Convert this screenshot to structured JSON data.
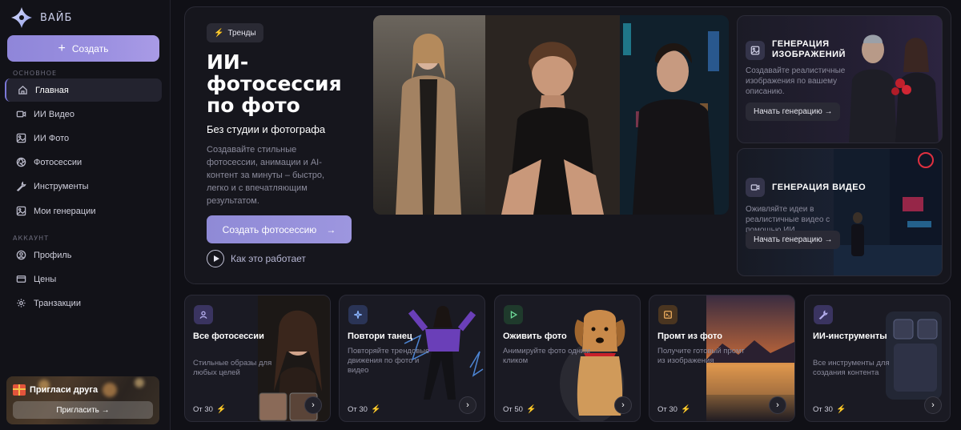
{
  "app": {
    "logo_text": "ВАЙБ"
  },
  "sidebar": {
    "create_label": "Создать",
    "section_main": "ОСНОВНОЕ",
    "section_account": "АККАУНТ",
    "main_items": [
      {
        "label": "Главная",
        "icon": "home-icon"
      },
      {
        "label": "ИИ Видео",
        "icon": "video-icon"
      },
      {
        "label": "ИИ Фото",
        "icon": "image-icon"
      },
      {
        "label": "Фотосессии",
        "icon": "aperture-icon"
      },
      {
        "label": "Инструменты",
        "icon": "wrench-icon"
      },
      {
        "label": "Мои генерации",
        "icon": "gallery-icon"
      }
    ],
    "account_items": [
      {
        "label": "Профиль",
        "icon": "user-icon"
      },
      {
        "label": "Цены",
        "icon": "card-icon"
      },
      {
        "label": "Транзакции",
        "icon": "gear-icon"
      }
    ],
    "invite": {
      "title": "Пригласи друга",
      "button": "Пригласить →"
    }
  },
  "hero": {
    "chip": "Тренды",
    "title": "ИИ-фотосессия по фото",
    "subtitle": "Без студии и фотографа",
    "description": "Создавайте стильные фотосессии, анимации и AI-контент за минуты – быстро, легко и с впечатляющим результатом.",
    "cta": "Создать фотосессию",
    "how_link": "Как это работает"
  },
  "side_cards": [
    {
      "title": "ГЕНЕРАЦИЯ ИЗОБРАЖЕНИЙ",
      "description": "Создавайте реалистичные изображения по вашему описанию.",
      "button": "Начать генерацию →"
    },
    {
      "title": "ГЕНЕРАЦИЯ ВИДЕО",
      "description": "Оживляйте идеи в реалистичные видео с помощью ИИ.",
      "button": "Начать генерацию →"
    }
  ],
  "cards": [
    {
      "title": "Все фотосессии",
      "description": "Стильные образы для любых целей",
      "price": "От 30",
      "icon_color": "#3a3460"
    },
    {
      "title": "Повтори танец",
      "description": "Повторяйте трендовые движения по фото и видео",
      "price": "От 30",
      "icon_color": "#2a3456"
    },
    {
      "title": "Оживить фото",
      "description": "Анимируйте фото одним кликом",
      "price": "От 50",
      "icon_color": "#1f3a2c"
    },
    {
      "title": "Промт из фото",
      "description": "Получите готовый промт из изображения",
      "price": "От 30",
      "icon_color": "#4a3520"
    },
    {
      "title": "ИИ-инструменты",
      "description": "Все инструменты для создания контента",
      "price": "От 30",
      "icon_color": "#3a3460"
    }
  ],
  "colors": {
    "accent": "#8f8ad6",
    "background": "#101016",
    "panel": "#16161d"
  }
}
